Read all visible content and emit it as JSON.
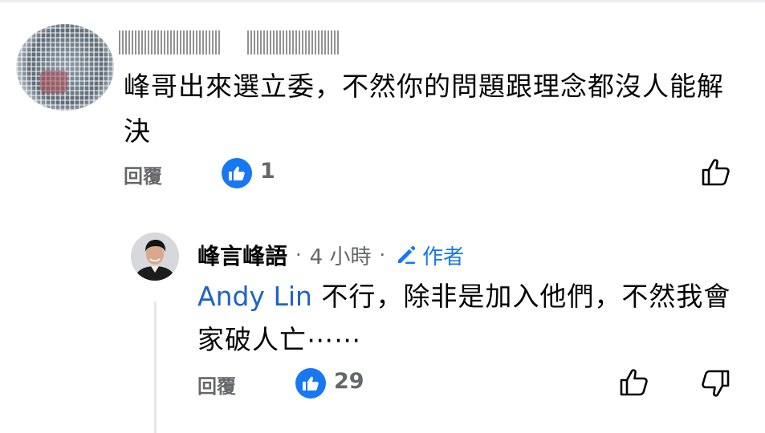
{
  "comment": {
    "text": "峰哥出來選立委，不然你的問題跟理念都沒人能解決",
    "reply_label": "回覆",
    "like_count": "1",
    "icons": {
      "reaction": "like-reaction-icon",
      "action": "thumbs-up-icon"
    }
  },
  "reply": {
    "author": "峰言峰語",
    "separator": "·",
    "time": "4 小時",
    "badge_label": "作者",
    "mention": "Andy Lin",
    "text": " 不行，除非是加入他們，不然我會家破人亡⋯⋯",
    "reply_label": "回覆",
    "like_count": "29",
    "icons": {
      "reaction": "like-reaction-icon",
      "like": "thumbs-up-icon",
      "dislike": "thumbs-down-icon",
      "badge": "pencil-icon"
    }
  },
  "colors": {
    "accent": "#1877f2",
    "mention": "#1d63c8",
    "muted": "#65676b",
    "text": "#050505",
    "thread_line": "#e4e6eb"
  }
}
